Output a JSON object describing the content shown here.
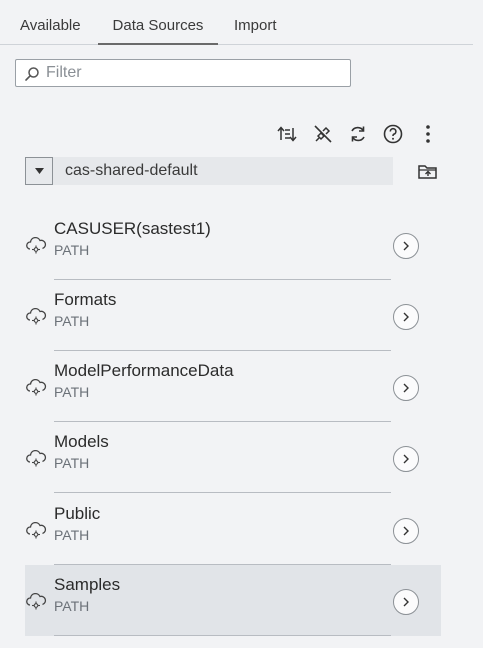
{
  "tabs": [
    {
      "label": "Available"
    },
    {
      "label": "Data Sources"
    },
    {
      "label": "Import"
    }
  ],
  "filter": {
    "placeholder": "Filter",
    "value": ""
  },
  "toolbar": {
    "icons": [
      "sort-icon",
      "disconnect-icon",
      "refresh-icon",
      "help-icon",
      "more-options-icon"
    ]
  },
  "library_select": {
    "value": "cas-shared-default"
  },
  "libraries": [
    {
      "name": "CASUSER(sastest1)",
      "type": "PATH"
    },
    {
      "name": "Formats",
      "type": "PATH"
    },
    {
      "name": "ModelPerformanceData",
      "type": "PATH"
    },
    {
      "name": "Models",
      "type": "PATH"
    },
    {
      "name": "Public",
      "type": "PATH"
    },
    {
      "name": "Samples",
      "type": "PATH",
      "selected": true
    }
  ]
}
